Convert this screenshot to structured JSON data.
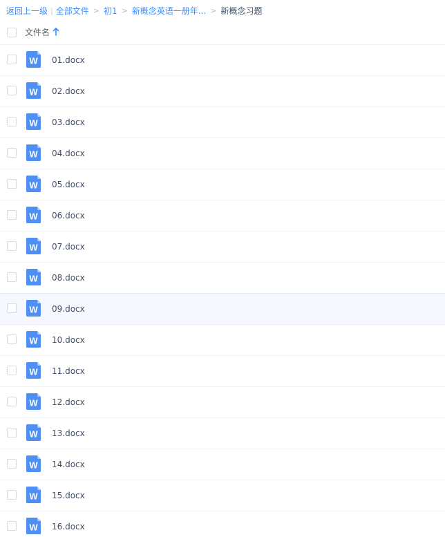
{
  "breadcrumb": {
    "back_label": "返回上一级",
    "separator_pipe": "|",
    "all_files_label": "全部文件",
    "arrow": ">",
    "path": [
      "初1",
      "新概念英语一册年..."
    ],
    "current": "新概念习题"
  },
  "header": {
    "name_column_label": "文件名",
    "sort_direction": "ascending",
    "sort_icon": "arrow-up-icon"
  },
  "files": [
    {
      "name": "01.docx",
      "icon": "word-doc-icon"
    },
    {
      "name": "02.docx",
      "icon": "word-doc-icon"
    },
    {
      "name": "03.docx",
      "icon": "word-doc-icon"
    },
    {
      "name": "04.docx",
      "icon": "word-doc-icon"
    },
    {
      "name": "05.docx",
      "icon": "word-doc-icon"
    },
    {
      "name": "06.docx",
      "icon": "word-doc-icon"
    },
    {
      "name": "07.docx",
      "icon": "word-doc-icon"
    },
    {
      "name": "08.docx",
      "icon": "word-doc-icon"
    },
    {
      "name": "09.docx",
      "icon": "word-doc-icon",
      "hovered": true
    },
    {
      "name": "10.docx",
      "icon": "word-doc-icon"
    },
    {
      "name": "11.docx",
      "icon": "word-doc-icon"
    },
    {
      "name": "12.docx",
      "icon": "word-doc-icon"
    },
    {
      "name": "13.docx",
      "icon": "word-doc-icon"
    },
    {
      "name": "14.docx",
      "icon": "word-doc-icon"
    },
    {
      "name": "15.docx",
      "icon": "word-doc-icon"
    },
    {
      "name": "16.docx",
      "icon": "word-doc-icon"
    }
  ],
  "word_icon_letter": "W",
  "colors": {
    "link": "#3b8cff",
    "word_icon": "#4d8ff5",
    "text": "#424e67",
    "hover_row": "#f5f9ff"
  }
}
